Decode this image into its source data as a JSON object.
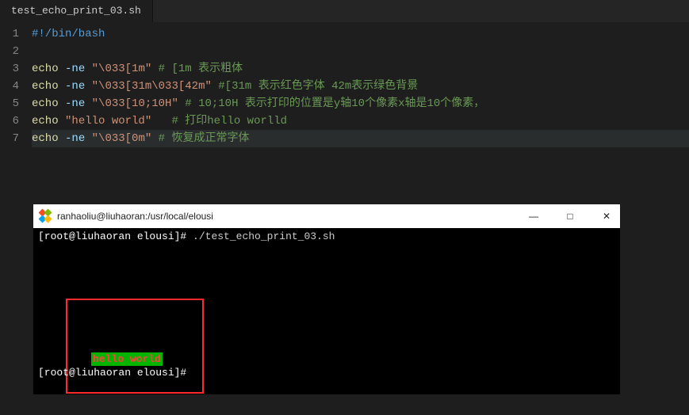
{
  "tab": {
    "filename": "test_echo_print_03.sh"
  },
  "gutter": [
    "1",
    "2",
    "3",
    "4",
    "5",
    "6",
    "7"
  ],
  "code": {
    "l1": {
      "shebang": "#!/bin/bash"
    },
    "l3": {
      "cmd": "echo",
      "opt": "-ne",
      "str": "\"\\033[1m\"",
      "cmt": "# [1m 表示粗体"
    },
    "l4": {
      "cmd": "echo",
      "opt": "-ne",
      "str": "\"\\033[31m\\033[42m\"",
      "cmt": "#[31m 表示红色字体 42m表示绿色背景"
    },
    "l5": {
      "cmd": "echo",
      "opt": "-ne",
      "str": "\"\\033[10;10H\"",
      "cmt": "# 10;10H 表示打印的位置是y轴10个像素x轴是10个像素，"
    },
    "l6": {
      "cmd": "echo",
      "str": "\"hello world\"",
      "cmt": "# 打印hello worlld"
    },
    "l7": {
      "cmd": "echo",
      "opt": "-ne",
      "str": "\"\\033[0m\"",
      "cmt": "# 恢复成正常字体"
    }
  },
  "terminal": {
    "title": "ranhaoliu@liuhaoran:/usr/local/elousi",
    "controls": {
      "min": "—",
      "max": "□",
      "close": "✕"
    },
    "prompt1_user": "[root@liuhaoran elousi]# ",
    "prompt1_cmd": "./test_echo_print_03.sh",
    "hello": "hello world",
    "prompt2": "[root@liuhaoran elousi]# "
  }
}
